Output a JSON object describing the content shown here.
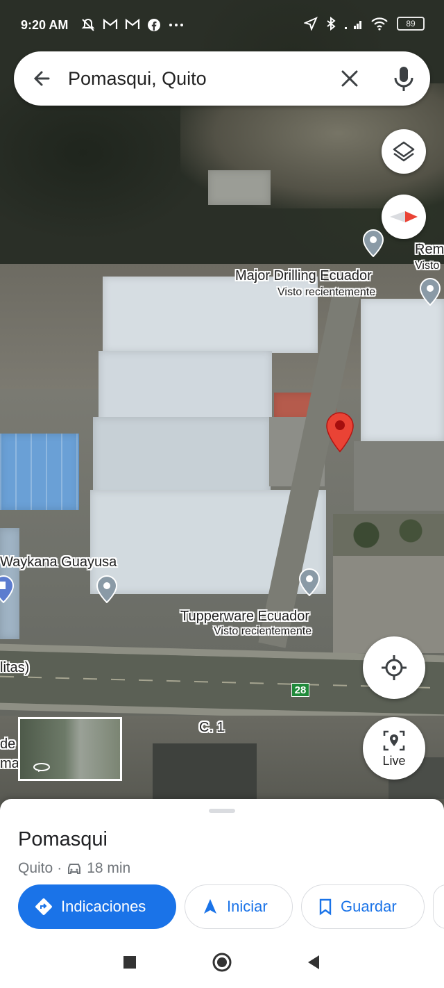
{
  "status_bar": {
    "time": "9:20 AM",
    "battery": "89",
    "left_icons": [
      "mute-icon",
      "gmail-icon",
      "gmail-icon",
      "facebook-icon",
      "more-icon"
    ],
    "right_icons": [
      "location-icon",
      "bluetooth-icon",
      "signal-icon",
      "wifi-icon",
      "battery-icon"
    ]
  },
  "search": {
    "query": "Pomasqui, Quito"
  },
  "map": {
    "labels": [
      {
        "title": "Major Drilling Ecuador",
        "subtitle": "Visto recientemente"
      },
      {
        "title": "Tupperware Ecuador",
        "subtitle": "Visto recientemente"
      },
      {
        "title": "Waykana Guayusa"
      },
      {
        "title": "Rem",
        "subtitle": "Visto"
      },
      {
        "title": "litas)"
      },
      {
        "title": "de"
      },
      {
        "title": "ma"
      },
      {
        "title": "C. 1"
      }
    ],
    "route_shield": "28"
  },
  "live_button": {
    "label": "Live"
  },
  "sheet": {
    "place_name": "Pomasqui",
    "city": "Quito",
    "separator": "·",
    "drive_time": "18 min",
    "actions": {
      "directions": "Indicaciones",
      "start": "Iniciar",
      "save": "Guardar"
    }
  },
  "colors": {
    "accent": "#1a73e8",
    "pin_red": "#ea4335",
    "poi_gray": "#8a9aa6"
  }
}
